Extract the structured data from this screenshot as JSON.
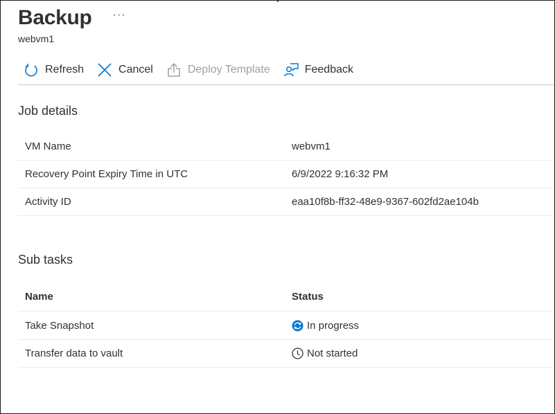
{
  "header": {
    "title": "Backup",
    "more_label": "···",
    "subtitle": "webvm1"
  },
  "toolbar": {
    "refresh_label": "Refresh",
    "cancel_label": "Cancel",
    "deploy_label": "Deploy Template",
    "feedback_label": "Feedback",
    "accent_color": "#0078d4",
    "disabled_color": "#a19f9d"
  },
  "job_details": {
    "title": "Job details",
    "rows": [
      {
        "key": "VM Name",
        "value": "webvm1"
      },
      {
        "key": "Recovery Point Expiry Time in UTC",
        "value": "6/9/2022 9:16:32 PM"
      },
      {
        "key": "Activity ID",
        "value": "eaa10f8b-ff32-48e9-9367-602fd2ae104b"
      }
    ]
  },
  "sub_tasks": {
    "title": "Sub tasks",
    "columns": [
      "Name",
      "Status"
    ],
    "rows": [
      {
        "name": "Take Snapshot",
        "status": "In progress",
        "status_icon": "sync-progress-icon"
      },
      {
        "name": "Transfer data to vault",
        "status": "Not started",
        "status_icon": "clock-icon"
      }
    ]
  }
}
